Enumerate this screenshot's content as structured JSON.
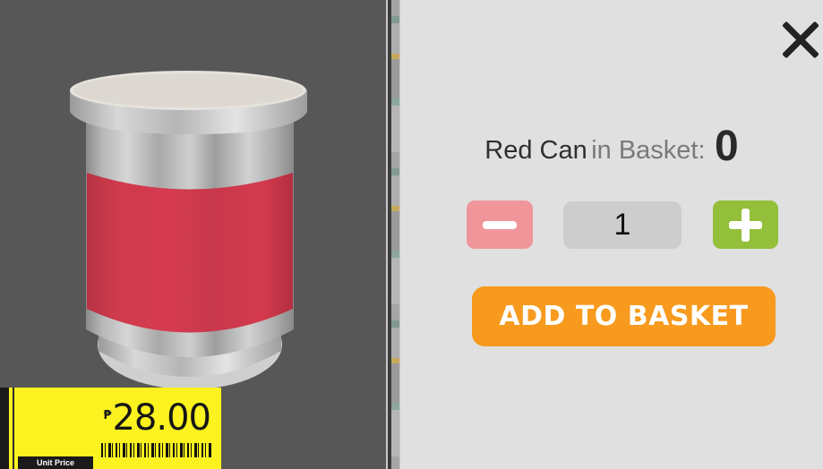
{
  "product": {
    "name": "Red Can",
    "in_basket_text": "in Basket:",
    "basket_count": "0"
  },
  "price_tag": {
    "currency": "₱",
    "amount": "28.00",
    "label": "Unit Price"
  },
  "quantity": {
    "value": "1"
  },
  "actions": {
    "add_to_basket": "ADD TO BASKET"
  },
  "icons": {
    "close": "close-icon",
    "decrement": "minus-icon",
    "increment": "plus-icon"
  },
  "colors": {
    "viewport_bg": "#575757",
    "panel_bg": "#e0e0e0",
    "minus_button": "#f0969b",
    "plus_button": "#93bf3b",
    "add_button": "#f79a1e",
    "price_tag": "#fbf21f",
    "can_label": "#d43a4e"
  }
}
